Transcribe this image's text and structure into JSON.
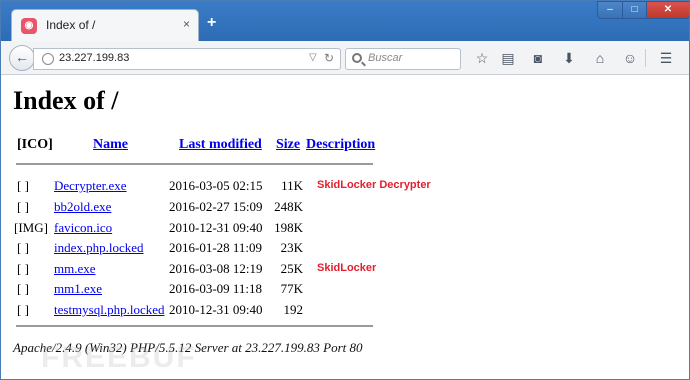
{
  "browser": {
    "tab_title": "Index of /",
    "tab_close": "×",
    "new_tab": "+",
    "window_controls": {
      "minimize": "–",
      "maximize": "□",
      "close": "✕"
    },
    "url": "23.227.199.83",
    "search_placeholder": "Buscar"
  },
  "page": {
    "title": "Index of /",
    "columns": {
      "icon": "[ICO]",
      "name": "Name",
      "last_modified": "Last modified",
      "size": "Size",
      "description": "Description"
    },
    "rows": [
      {
        "icon": "[ ]",
        "name": "Decrypter.exe",
        "modified": "2016-03-05 02:15",
        "size": "11K"
      },
      {
        "icon": "[ ]",
        "name": "bb2old.exe",
        "modified": "2016-02-27 15:09",
        "size": "248K"
      },
      {
        "icon": "[IMG]",
        "name": "favicon.ico",
        "modified": "2010-12-31 09:40",
        "size": "198K"
      },
      {
        "icon": "[ ]",
        "name": "index.php.locked",
        "modified": "2016-01-28 11:09",
        "size": "23K"
      },
      {
        "icon": "[ ]",
        "name": "mm.exe",
        "modified": "2016-03-08 12:19",
        "size": "25K"
      },
      {
        "icon": "[ ]",
        "name": "mm1.exe",
        "modified": "2016-03-09 11:18",
        "size": "77K"
      },
      {
        "icon": "[ ]",
        "name": "testmysql.php.locked",
        "modified": "2010-12-31 09:40",
        "size": "192"
      }
    ],
    "footer": "Apache/2.4.9 (Win32) PHP/5.5.12 Server at 23.227.199.83 Port 80"
  },
  "annotations": [
    {
      "text": "SkidLocker Decrypter",
      "row": 0
    },
    {
      "text": "SkidLocker",
      "row": 4
    }
  ],
  "watermark": "FREEBUF",
  "colors": {
    "link": "#0000ee",
    "annotation": "#e32030",
    "titlebar": "#2d6cb5"
  }
}
